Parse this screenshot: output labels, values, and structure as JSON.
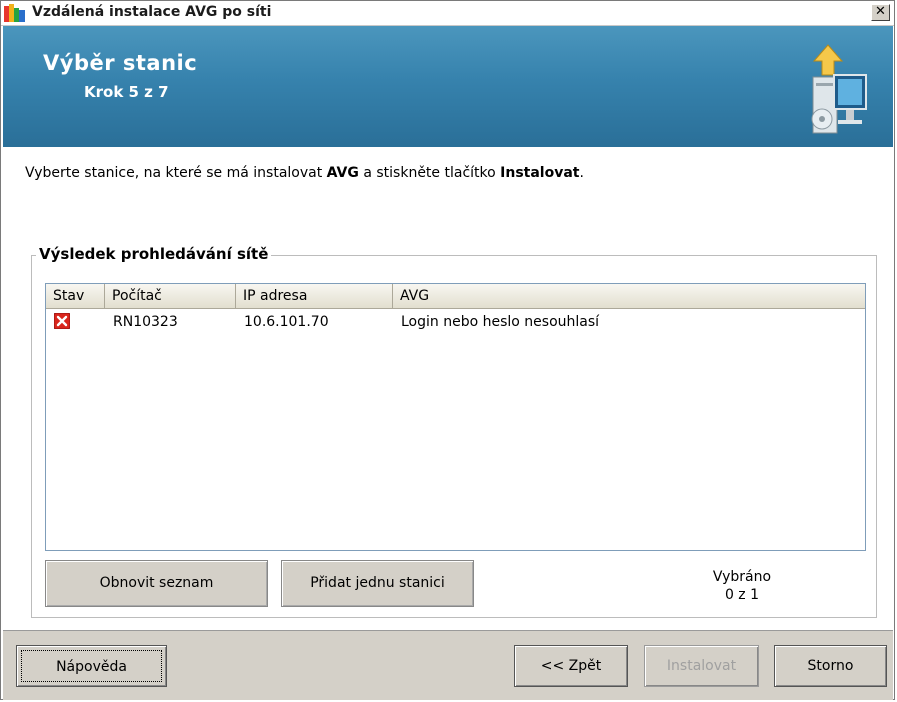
{
  "window": {
    "title": "Vzdálená instalace AVG po síti",
    "close_glyph": "✕"
  },
  "banner": {
    "title": "Výběr stanic",
    "step": "Krok 5 z 7",
    "icon": "computer-install-icon"
  },
  "instructions": {
    "part1": "Vyberte stanice, na které se má instalovat ",
    "bold1": "AVG",
    "part2": " a stiskněte tlačítko ",
    "bold2": "Instalovat",
    "part3": "."
  },
  "scan_results": {
    "legend": "Výsledek prohledávání sítě",
    "columns": [
      "Stav",
      "Počítač",
      "IP adresa",
      "AVG"
    ],
    "rows": [
      {
        "status_icon": "error-icon",
        "computer": "RN10323",
        "ip": "10.6.101.70",
        "avg": "Login nebo heslo nesouhlasí"
      }
    ],
    "refresh_button": "Obnovit seznam",
    "add_station_button": "Přidat jednu stanici",
    "selected_label": "Vybráno",
    "selected_count": "0 z 1"
  },
  "footer": {
    "help_button": "Nápověda",
    "back_button": "<< Zpět",
    "install_button": "Instalovat",
    "cancel_button": "Storno"
  },
  "colors": {
    "banner": "#3682ad",
    "error": "#d9261c"
  }
}
